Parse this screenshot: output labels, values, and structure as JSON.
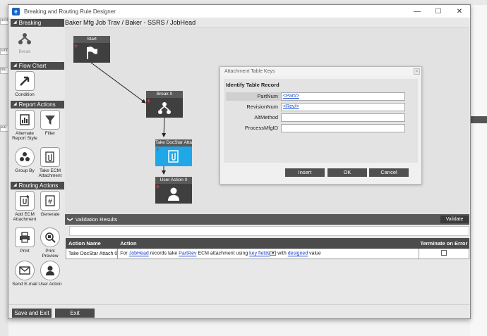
{
  "window": {
    "title": "Breaking and Routing Rule Designer",
    "app_icon": "e",
    "minimize_icon": "—",
    "maximize_icon": "☐",
    "close_icon": "✕"
  },
  "background": {
    "left_chips": [
      "omb",
      "smb",
      "bki",
      "eld"
    ]
  },
  "sidebar": {
    "breaking": {
      "header": "Breaking",
      "tools": [
        {
          "label": "Break",
          "icon": "branch-icon"
        }
      ]
    },
    "flow_chart": {
      "header": "Flow Chart",
      "tools": [
        {
          "label": "Condition",
          "icon": "condition-arrow-icon"
        }
      ]
    },
    "report_actions": {
      "header": "Report Actions",
      "tools": [
        {
          "label": "Alternate Report Style",
          "icon": "report-style-icon"
        },
        {
          "label": "Filter",
          "icon": "filter-icon"
        },
        {
          "label": "Group By",
          "icon": "group-by-icon"
        },
        {
          "label": "Take ECM Attachment",
          "icon": "ecm-attachment-icon"
        }
      ]
    },
    "routing_actions": {
      "header": "Routing Actions",
      "tools": [
        {
          "label": "Add ECM Attachment",
          "icon": "add-attachment-icon"
        },
        {
          "label": "Generate",
          "icon": "generate-icon"
        },
        {
          "label": "Print",
          "icon": "print-icon"
        },
        {
          "label": "Print Preview",
          "icon": "print-preview-icon"
        },
        {
          "label": "Send E-mail",
          "icon": "email-icon"
        },
        {
          "label": "User Action",
          "icon": "user-action-icon"
        }
      ]
    }
  },
  "breadcrumb": "Baker Mfg Job Trav / Baker - SSRS / JobHead",
  "canvas": {
    "nodes": [
      {
        "title": "Start",
        "icon": "flag-icon"
      },
      {
        "title": "Break 0",
        "icon": "branch-icon"
      },
      {
        "title": "Take DocStar Attac",
        "icon": "attachment-icon"
      },
      {
        "title": "User Action 0",
        "icon": "user-icon"
      }
    ]
  },
  "dialog": {
    "title": "Attachment Table Keys",
    "close": "×",
    "section_title": "Identify Table Record",
    "fields": [
      {
        "label": "PartNum",
        "value": "<Part/>"
      },
      {
        "label": "RevisionNum",
        "value": "<Rev/>"
      },
      {
        "label": "AltMethod",
        "value": ""
      },
      {
        "label": "ProcessMfgID",
        "value": ""
      }
    ],
    "buttons": {
      "insert": "Insert",
      "ok": "OK",
      "cancel": "Cancel"
    }
  },
  "validation": {
    "header": "Validation Results",
    "chevron": "❯",
    "validate_label": "Validate",
    "columns": [
      "Action Name",
      "Action",
      "Terminate on Error"
    ],
    "rows": [
      {
        "action_name": "Take DocStar Attach 0",
        "t1": "For ",
        "l1": "JobHead",
        "t2": " records take ",
        "l2": "PartRev",
        "t3": " ECM attachment using ",
        "l3": "key fields",
        "t4": " with ",
        "l4": "designed",
        "t5": " value",
        "terminate_on_error": false
      }
    ]
  },
  "footer": {
    "save_exit": "Save and Exit",
    "exit": "Exit"
  }
}
